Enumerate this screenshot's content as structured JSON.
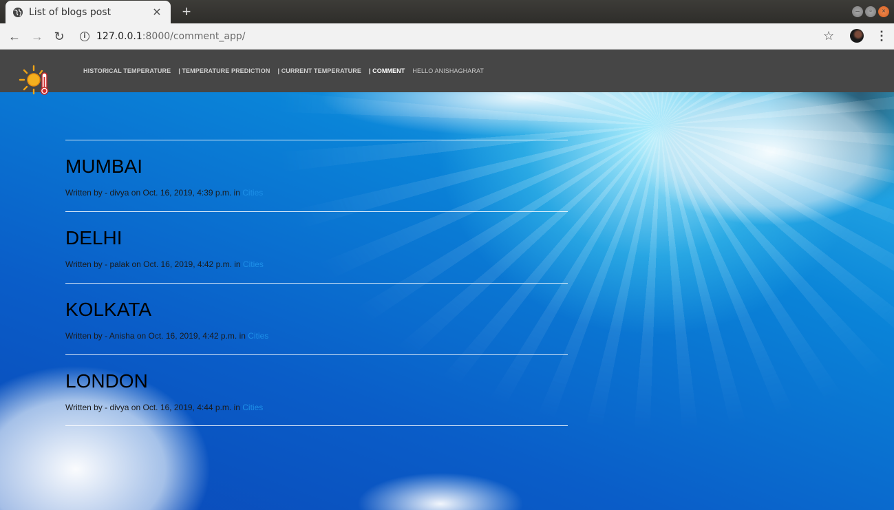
{
  "browser": {
    "tab_title": "List of blogs post",
    "tab_close": "✕",
    "new_tab": "+",
    "url_host": "127.0.0.1",
    "url_rest": ":8000/comment_app/"
  },
  "nav": {
    "items": [
      {
        "label": "HISTORICAL TEMPERATURE"
      },
      {
        "label": "| TEMPERATURE PREDICTION"
      },
      {
        "label": "| CURRENT TEMPERATURE"
      },
      {
        "label": "| COMMENT"
      }
    ],
    "greeting": "HELLO ANISHAGHARAT"
  },
  "posts": [
    {
      "title": "MUMBAI",
      "meta_prefix": "Written by - divya on Oct. 16, 2019, 4:39 p.m. in",
      "category": "Cities"
    },
    {
      "title": "DELHI",
      "meta_prefix": "Written by - palak on Oct. 16, 2019, 4:42 p.m. in",
      "category": "Cities"
    },
    {
      "title": "KOLKATA",
      "meta_prefix": "Written by - Anisha on Oct. 16, 2019, 4:42 p.m. in",
      "category": "Cities"
    },
    {
      "title": "LONDON",
      "meta_prefix": "Written by - divya on Oct. 16, 2019, 4:44 p.m. in",
      "category": "Cities"
    }
  ],
  "colors": {
    "navbar": "#464646",
    "link": "#1e90e8",
    "active_nav": "#ffffff"
  }
}
